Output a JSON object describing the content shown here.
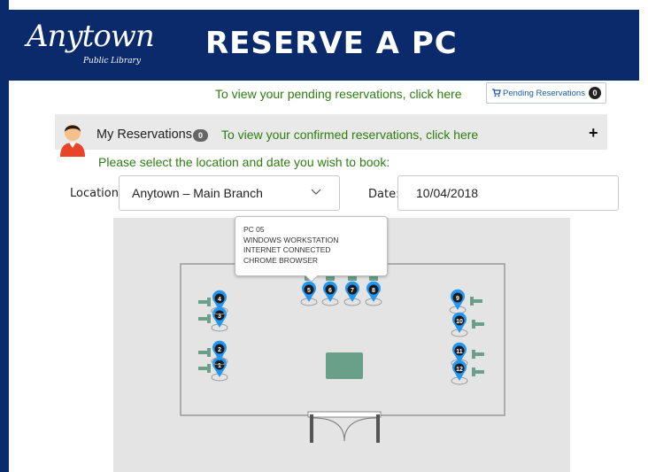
{
  "header": {
    "logo_script": "Anytown",
    "logo_sub": "Public Library",
    "title": "RESERVE A PC",
    "bg_color": "#0a2a6b"
  },
  "pending": {
    "message": "To view your pending reservations, click here",
    "button_label": "Pending Reservations",
    "button_count": "0",
    "icon": "cart-icon"
  },
  "my_reservations": {
    "label": "My Reservations",
    "count": "0",
    "message": "To view your confirmed reservations, click here",
    "expand": "+"
  },
  "form": {
    "prompt": "Please select the location and date you wish to book:",
    "location_label": "Location:",
    "location_value": "Anytown – Main Branch",
    "date_label": "Date:",
    "date_value": "10/04/2018"
  },
  "tooltip": {
    "lines": [
      "PC 05",
      "WINDOWS WORKSTATION",
      "INTERNET CONNECTED",
      "CHROME BROWSER"
    ]
  },
  "map": {
    "pcs": [
      "1",
      "2",
      "3",
      "4",
      "5",
      "6",
      "7",
      "8",
      "9",
      "10",
      "11",
      "12"
    ],
    "pin_color": "#2196f3",
    "desk_color": "#6aa08a"
  },
  "colors": {
    "accent_green": "#2e7d12",
    "link_blue": "#1a5aa6"
  }
}
